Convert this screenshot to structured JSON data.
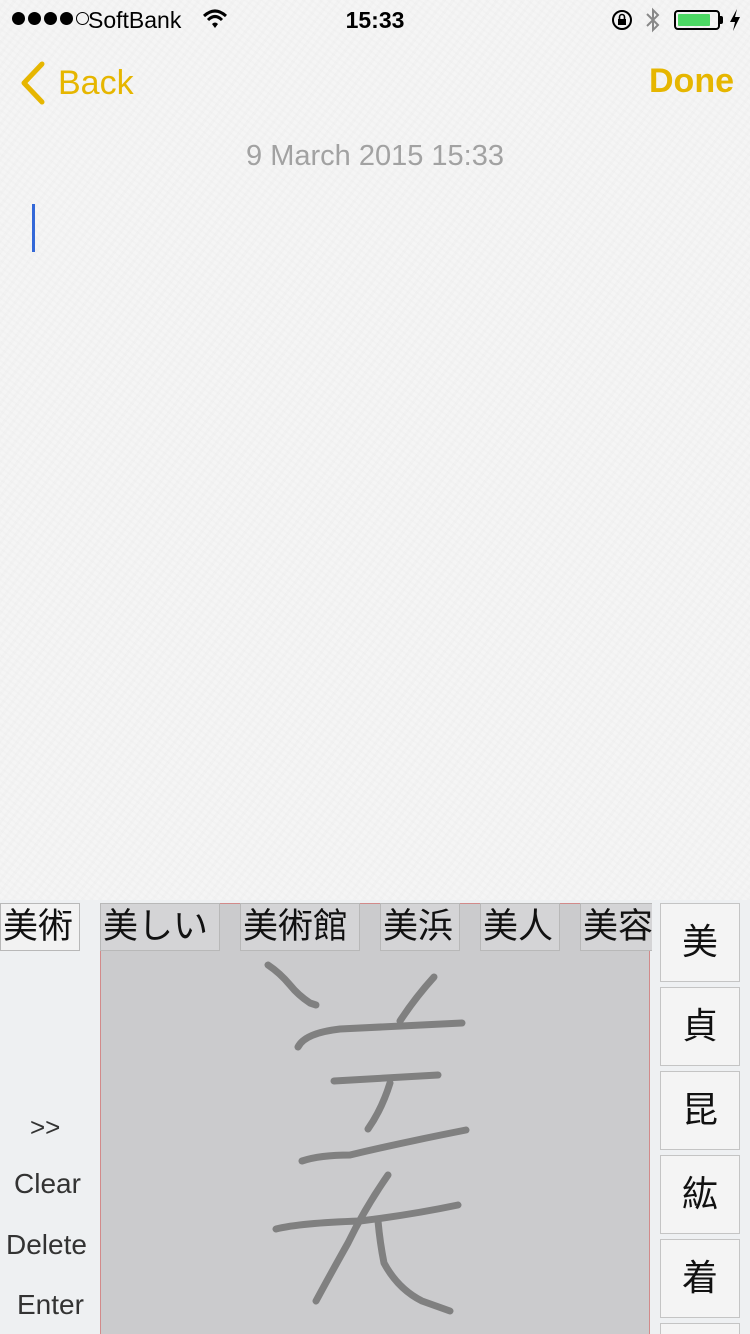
{
  "status_bar": {
    "carrier": "SoftBank",
    "time": "15:33",
    "signal_bars_filled": 4,
    "signal_bars_total": 5,
    "battery_level": 0.85,
    "battery_color": "#4cd964",
    "icons": [
      "wifi-icon",
      "orientation-lock-icon",
      "bluetooth-icon",
      "battery-icon",
      "charging-icon"
    ]
  },
  "nav": {
    "back_label": "Back",
    "done_label": "Done",
    "accent_color": "#e6b600"
  },
  "note": {
    "date": "9 March 2015 15:33",
    "body": ""
  },
  "keyboard": {
    "candidates": [
      "美術",
      "美しい",
      "美術館",
      "美浜",
      "美人",
      "美容"
    ],
    "side_keys": {
      "more": ">>",
      "clear": "Clear",
      "delete": "Delete",
      "enter": "Enter"
    },
    "kanji_suggestions": [
      "美",
      "貞",
      "昆",
      "紘",
      "着"
    ]
  }
}
